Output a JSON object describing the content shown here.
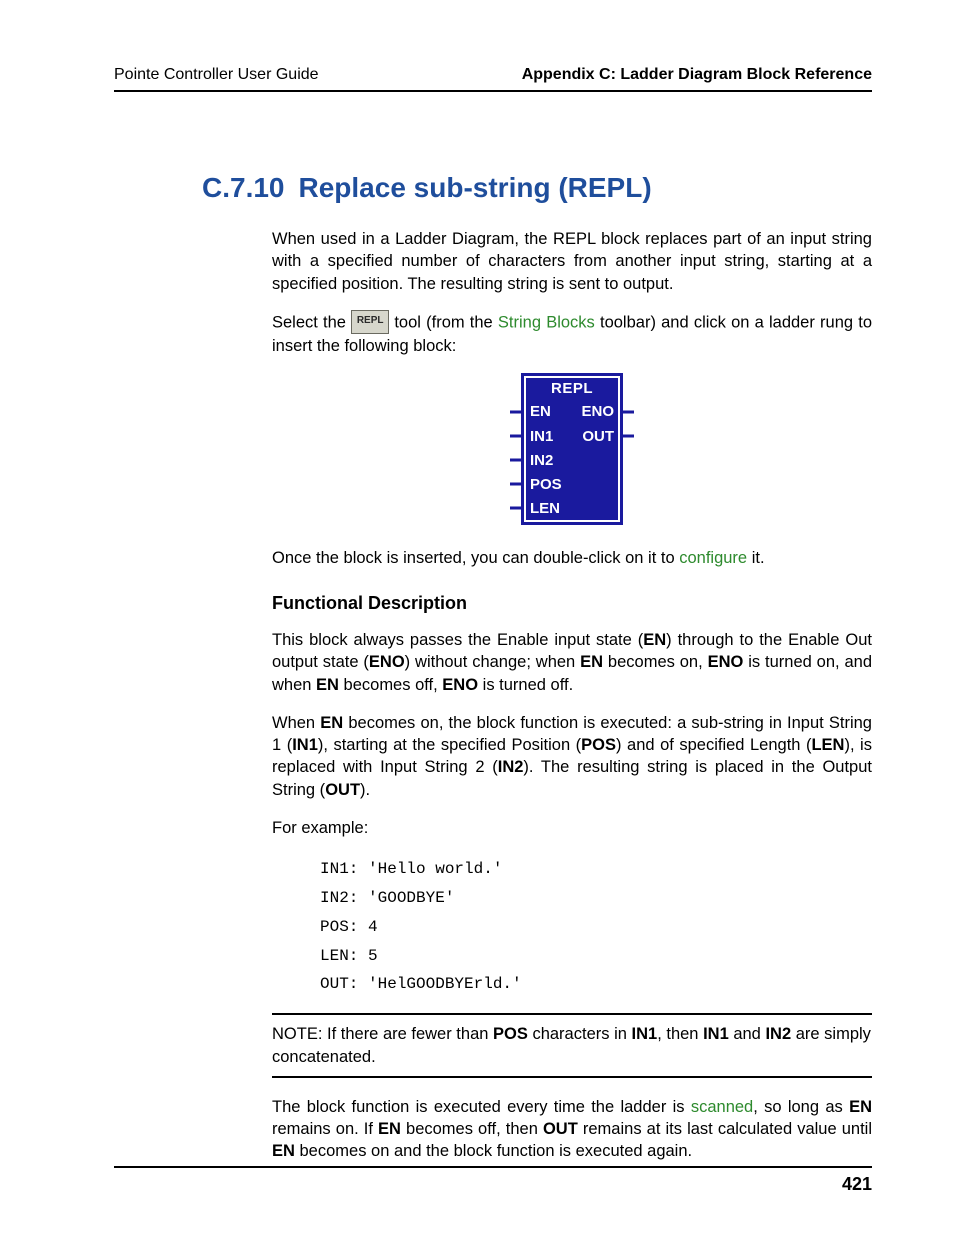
{
  "header": {
    "left": "Pointe Controller User Guide",
    "right": "Appendix C: Ladder Diagram Block Reference"
  },
  "heading": {
    "number": "C.7.10",
    "title": "Replace sub-string (REPL)"
  },
  "intro_para": "When used in a Ladder Diagram, the REPL block replaces part of an input string with a specified number of characters from another input string, starting at a specified position. The resulting string is sent to output.",
  "select_sentence": {
    "pre": "Select the ",
    "tool_label": "REPL",
    "mid": " tool (from the ",
    "link": "String Blocks",
    "post": " toolbar) and click on a ladder rung to insert the following block:"
  },
  "block": {
    "title": "REPL",
    "left_pins": [
      "EN",
      "IN1",
      "IN2",
      "POS",
      "LEN"
    ],
    "right_pins": [
      "ENO",
      "OUT"
    ]
  },
  "after_block": {
    "pre": "Once the block is inserted, you can double-click on it to ",
    "link": "configure",
    "post": " it."
  },
  "func_desc_heading": "Functional Description",
  "func_p1": {
    "t1": "This block always passes the Enable input state (",
    "b1": "EN",
    "t2": ") through to the Enable Out output state (",
    "b2": "ENO",
    "t3": ") without change; when ",
    "b3": "EN",
    "t4": " becomes on, ",
    "b4": "ENO",
    "t5": " is turned on, and when ",
    "b5": "EN",
    "t6": " becomes off, ",
    "b6": "ENO",
    "t7": " is turned off."
  },
  "func_p2": {
    "t1": "When ",
    "b1": "EN",
    "t2": " becomes on, the block function is executed: a sub-string in Input String 1 (",
    "b2": "IN1",
    "t3": "), starting at the specified Position (",
    "b3": "POS",
    "t4": ") and of specified Length (",
    "b4": "LEN",
    "t5": "), is replaced with Input String 2 (",
    "b5": "IN2",
    "t6": "). The resulting string is placed in the Output String (",
    "b6": "OUT",
    "t7": ")."
  },
  "for_example": "For example:",
  "example": "IN1: 'Hello world.'\nIN2: 'GOODBYE'\nPOS: 4\nLEN: 5\nOUT: 'HelGOODBYErld.'",
  "note": {
    "t1": "NOTE: If there are fewer than ",
    "b1": "POS",
    "t2": " characters in ",
    "b2": "IN1",
    "t3": ", then ",
    "b3": "IN1",
    "t4": " and ",
    "b4": "IN2",
    "t5": " are simply concatenated."
  },
  "scan_para": {
    "t1": "The block function is executed every time the ladder is ",
    "link": "scanned",
    "t2": ", so long as ",
    "b1": "EN",
    "t3": " remains on. If ",
    "b2": "EN",
    "t4": " becomes off, then ",
    "b3": "OUT",
    "t5": " remains at its last calculated value until ",
    "b4": "EN",
    "t6": " becomes on and the block function is executed again."
  },
  "page_number": "421"
}
